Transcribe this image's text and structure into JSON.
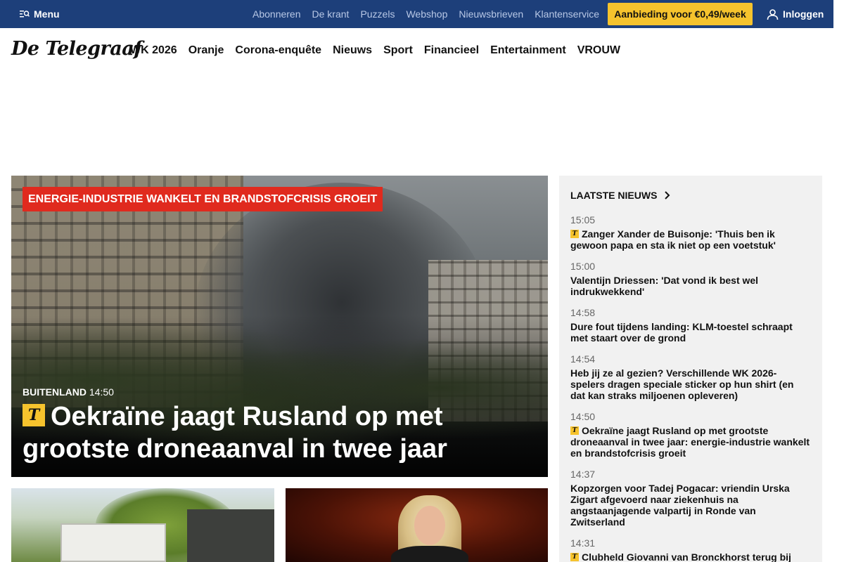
{
  "topbar": {
    "menu_label": "Menu",
    "links": [
      "Abonneren",
      "De krant",
      "Puzzels",
      "Webshop",
      "Nieuwsbrieven",
      "Klantenservice"
    ],
    "offer_label": "Aanbieding voor €0,49/week",
    "login_label": "Inloggen",
    "bg_color": "#1d3f7a",
    "offer_color": "#f6c32d"
  },
  "nav": {
    "logo": "De Telegraaf",
    "links": [
      "WK 2026",
      "Oranje",
      "Corona-enquête",
      "Nieuws",
      "Sport",
      "Financieel",
      "Entertainment",
      "VROUW"
    ]
  },
  "hero": {
    "tag": "ENERGIE-INDUSTRIE WANKELT EN BRANDSTOFCRISIS GROEIT",
    "section": "BUITENLAND",
    "time": "14:50",
    "badge": "T",
    "headline": "Oekraïne jaagt Rusland op met grootste droneaanval in twee jaar",
    "tag_color": "#e02a1e"
  },
  "sidebar": {
    "title": "LAATSTE NIEUWS",
    "items": [
      {
        "time": "15:05",
        "premium": true,
        "text": "Zanger Xander de Buisonje: 'Thuis ben ik gewoon papa en sta ik niet op een voetstuk'"
      },
      {
        "time": "15:00",
        "premium": false,
        "text": "Valentijn Driessen: 'Dat vond ik best wel indrukwekkend'"
      },
      {
        "time": "14:58",
        "premium": false,
        "text": "Dure fout tijdens landing: KLM-toestel schraapt met staart over de grond"
      },
      {
        "time": "14:54",
        "premium": false,
        "text": "Heb jij ze al gezien? Verschillende WK 2026-spelers dragen speciale sticker op hun shirt (en dat kan straks miljoenen opleveren)"
      },
      {
        "time": "14:50",
        "premium": true,
        "text": "Oekraïne jaagt Rusland op met grootste droneaanval in twee jaar: energie-industrie wankelt en brandstofcrisis groeit"
      },
      {
        "time": "14:37",
        "premium": false,
        "text": "Kopzorgen voor Tadej Pogacar: vriendin Urska Zigart afgevoerd naar ziekenhuis na angstaanjagende valpartij in Ronde van Zwitserland"
      },
      {
        "time": "14:31",
        "premium": true,
        "text": "Clubheld Giovanni van Bronckhorst terug bij"
      }
    ]
  }
}
